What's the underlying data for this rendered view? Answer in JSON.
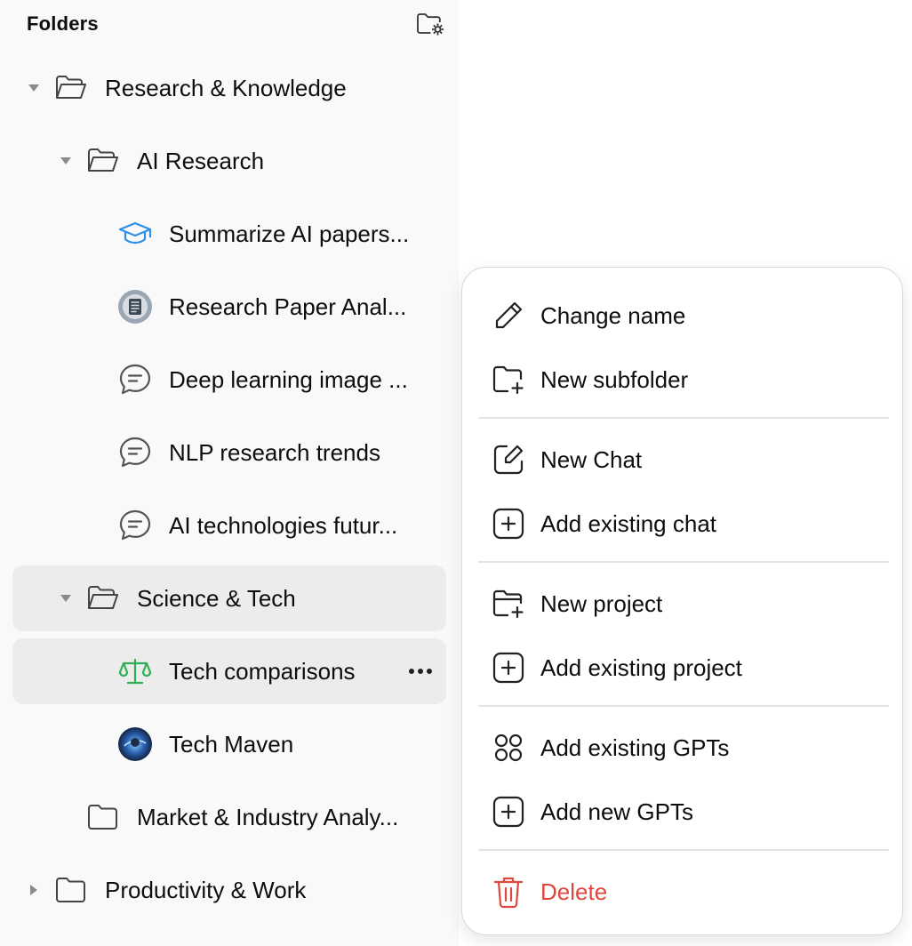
{
  "sidebar": {
    "title": "Folders",
    "settings_icon": "folder-settings-icon",
    "items": [
      {
        "label": "Research & Knowledge",
        "icon": "folder-open-icon",
        "expanded": true
      },
      {
        "label": "AI Research",
        "icon": "folder-open-icon",
        "expanded": true
      },
      {
        "label": "Summarize AI papers...",
        "icon": "graduation-cap-icon"
      },
      {
        "label": "Research Paper Anal...",
        "icon": "gpt-avatar"
      },
      {
        "label": "Deep learning image ...",
        "icon": "chat-bubble-icon"
      },
      {
        "label": "NLP research trends",
        "icon": "chat-bubble-icon"
      },
      {
        "label": "AI technologies futur...",
        "icon": "chat-bubble-icon"
      },
      {
        "label": "Science & Tech",
        "icon": "folder-open-icon",
        "expanded": true
      },
      {
        "label": "Tech comparisons",
        "icon": "scale-icon"
      },
      {
        "label": "Tech Maven",
        "icon": "gpt-avatar"
      },
      {
        "label": "Market & Industry Analy...",
        "icon": "folder-icon"
      },
      {
        "label": "Productivity & Work",
        "icon": "folder-icon",
        "expanded": false
      }
    ]
  },
  "context_menu": {
    "items": [
      {
        "label": "Change name",
        "icon": "pencil-icon"
      },
      {
        "label": "New subfolder",
        "icon": "folder-plus-icon"
      },
      {
        "label": "New Chat",
        "icon": "edit-square-icon"
      },
      {
        "label": "Add existing chat",
        "icon": "plus-square-icon"
      },
      {
        "label": "New project",
        "icon": "folder-plus-icon"
      },
      {
        "label": "Add existing project",
        "icon": "plus-square-icon"
      },
      {
        "label": "Add existing GPTs",
        "icon": "grid-circles-icon"
      },
      {
        "label": "Add new GPTs",
        "icon": "plus-square-icon"
      },
      {
        "label": "Delete",
        "icon": "trash-icon"
      }
    ]
  },
  "colors": {
    "sidebar_bg": "#f9f9f9",
    "highlight_bg": "#ececec",
    "danger": "#e0483e",
    "accent_blue": "#2f8fe6",
    "accent_green": "#2fae56"
  }
}
